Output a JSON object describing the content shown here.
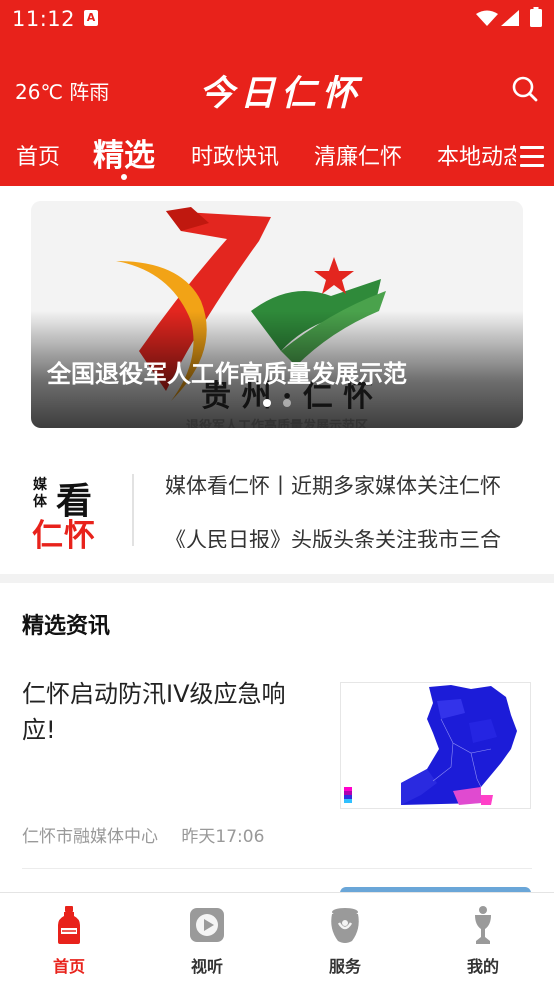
{
  "status_bar": {
    "time": "11:12",
    "notification_icon": "a-app-icon",
    "icons": [
      "wifi-icon",
      "cellular-signal-icon",
      "battery-icon"
    ]
  },
  "header": {
    "weather": "26℃ 阵雨",
    "app_title": "今日仁怀",
    "search_icon": "search-icon",
    "menu_icon": "menu-icon"
  },
  "nav": {
    "tabs": [
      {
        "label": "首页",
        "active": false
      },
      {
        "label": "精选",
        "active": true
      },
      {
        "label": "时政快讯",
        "active": false
      },
      {
        "label": "清廉仁怀",
        "active": false
      },
      {
        "label": "本地动态",
        "active": false
      }
    ]
  },
  "banner": {
    "title": "全国退役军人工作高质量发展示范",
    "subtitle": "退役军人工作高质量发展示范区",
    "slide_count": 2,
    "active_slide": 0
  },
  "media": {
    "logo": {
      "small_top": "媒",
      "small_bottom": "体",
      "big": "看",
      "red": "仁怀"
    },
    "headlines": [
      "媒体看仁怀丨近期多家媒体关注仁怀",
      "《人民日报》头版头条关注我市三合"
    ]
  },
  "featured": {
    "section_title": "精选资讯",
    "items": [
      {
        "headline": "仁怀启动防汛IV级应急响应!",
        "source": "仁怀市融媒体中心",
        "time": "昨天17:06",
        "thumbnail": "rainfall-map-thumbnail"
      }
    ]
  },
  "bottom_nav": {
    "items": [
      {
        "label": "首页",
        "icon": "home-bottle-icon",
        "active": true
      },
      {
        "label": "视听",
        "icon": "video-play-icon",
        "active": false
      },
      {
        "label": "服务",
        "icon": "service-jar-icon",
        "active": false
      },
      {
        "label": "我的",
        "icon": "profile-trophy-icon",
        "active": false
      }
    ]
  },
  "colors": {
    "brand_red": "#e8221b",
    "text_primary": "#222222",
    "text_muted": "#999999"
  }
}
